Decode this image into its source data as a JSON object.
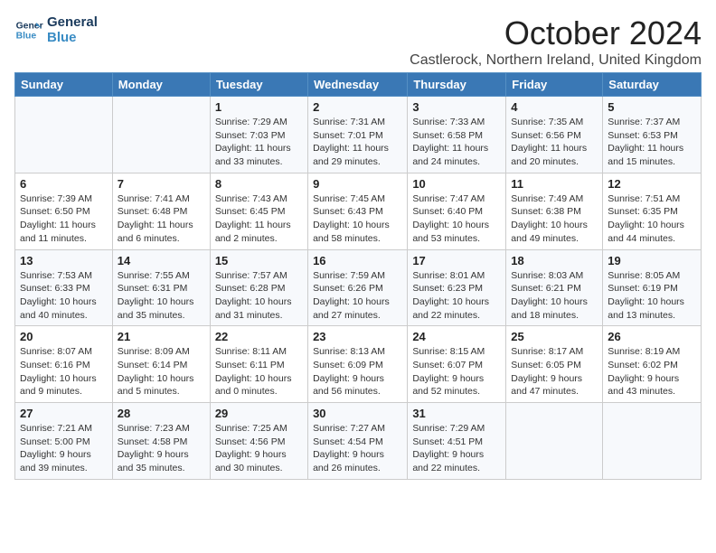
{
  "logo": {
    "line1": "General",
    "line2": "Blue"
  },
  "title": "October 2024",
  "location": "Castlerock, Northern Ireland, United Kingdom",
  "days_header": [
    "Sunday",
    "Monday",
    "Tuesday",
    "Wednesday",
    "Thursday",
    "Friday",
    "Saturday"
  ],
  "weeks": [
    [
      {
        "num": "",
        "info": ""
      },
      {
        "num": "",
        "info": ""
      },
      {
        "num": "1",
        "info": "Sunrise: 7:29 AM\nSunset: 7:03 PM\nDaylight: 11 hours\nand 33 minutes."
      },
      {
        "num": "2",
        "info": "Sunrise: 7:31 AM\nSunset: 7:01 PM\nDaylight: 11 hours\nand 29 minutes."
      },
      {
        "num": "3",
        "info": "Sunrise: 7:33 AM\nSunset: 6:58 PM\nDaylight: 11 hours\nand 24 minutes."
      },
      {
        "num": "4",
        "info": "Sunrise: 7:35 AM\nSunset: 6:56 PM\nDaylight: 11 hours\nand 20 minutes."
      },
      {
        "num": "5",
        "info": "Sunrise: 7:37 AM\nSunset: 6:53 PM\nDaylight: 11 hours\nand 15 minutes."
      }
    ],
    [
      {
        "num": "6",
        "info": "Sunrise: 7:39 AM\nSunset: 6:50 PM\nDaylight: 11 hours\nand 11 minutes."
      },
      {
        "num": "7",
        "info": "Sunrise: 7:41 AM\nSunset: 6:48 PM\nDaylight: 11 hours\nand 6 minutes."
      },
      {
        "num": "8",
        "info": "Sunrise: 7:43 AM\nSunset: 6:45 PM\nDaylight: 11 hours\nand 2 minutes."
      },
      {
        "num": "9",
        "info": "Sunrise: 7:45 AM\nSunset: 6:43 PM\nDaylight: 10 hours\nand 58 minutes."
      },
      {
        "num": "10",
        "info": "Sunrise: 7:47 AM\nSunset: 6:40 PM\nDaylight: 10 hours\nand 53 minutes."
      },
      {
        "num": "11",
        "info": "Sunrise: 7:49 AM\nSunset: 6:38 PM\nDaylight: 10 hours\nand 49 minutes."
      },
      {
        "num": "12",
        "info": "Sunrise: 7:51 AM\nSunset: 6:35 PM\nDaylight: 10 hours\nand 44 minutes."
      }
    ],
    [
      {
        "num": "13",
        "info": "Sunrise: 7:53 AM\nSunset: 6:33 PM\nDaylight: 10 hours\nand 40 minutes."
      },
      {
        "num": "14",
        "info": "Sunrise: 7:55 AM\nSunset: 6:31 PM\nDaylight: 10 hours\nand 35 minutes."
      },
      {
        "num": "15",
        "info": "Sunrise: 7:57 AM\nSunset: 6:28 PM\nDaylight: 10 hours\nand 31 minutes."
      },
      {
        "num": "16",
        "info": "Sunrise: 7:59 AM\nSunset: 6:26 PM\nDaylight: 10 hours\nand 27 minutes."
      },
      {
        "num": "17",
        "info": "Sunrise: 8:01 AM\nSunset: 6:23 PM\nDaylight: 10 hours\nand 22 minutes."
      },
      {
        "num": "18",
        "info": "Sunrise: 8:03 AM\nSunset: 6:21 PM\nDaylight: 10 hours\nand 18 minutes."
      },
      {
        "num": "19",
        "info": "Sunrise: 8:05 AM\nSunset: 6:19 PM\nDaylight: 10 hours\nand 13 minutes."
      }
    ],
    [
      {
        "num": "20",
        "info": "Sunrise: 8:07 AM\nSunset: 6:16 PM\nDaylight: 10 hours\nand 9 minutes."
      },
      {
        "num": "21",
        "info": "Sunrise: 8:09 AM\nSunset: 6:14 PM\nDaylight: 10 hours\nand 5 minutes."
      },
      {
        "num": "22",
        "info": "Sunrise: 8:11 AM\nSunset: 6:11 PM\nDaylight: 10 hours\nand 0 minutes."
      },
      {
        "num": "23",
        "info": "Sunrise: 8:13 AM\nSunset: 6:09 PM\nDaylight: 9 hours\nand 56 minutes."
      },
      {
        "num": "24",
        "info": "Sunrise: 8:15 AM\nSunset: 6:07 PM\nDaylight: 9 hours\nand 52 minutes."
      },
      {
        "num": "25",
        "info": "Sunrise: 8:17 AM\nSunset: 6:05 PM\nDaylight: 9 hours\nand 47 minutes."
      },
      {
        "num": "26",
        "info": "Sunrise: 8:19 AM\nSunset: 6:02 PM\nDaylight: 9 hours\nand 43 minutes."
      }
    ],
    [
      {
        "num": "27",
        "info": "Sunrise: 7:21 AM\nSunset: 5:00 PM\nDaylight: 9 hours\nand 39 minutes."
      },
      {
        "num": "28",
        "info": "Sunrise: 7:23 AM\nSunset: 4:58 PM\nDaylight: 9 hours\nand 35 minutes."
      },
      {
        "num": "29",
        "info": "Sunrise: 7:25 AM\nSunset: 4:56 PM\nDaylight: 9 hours\nand 30 minutes."
      },
      {
        "num": "30",
        "info": "Sunrise: 7:27 AM\nSunset: 4:54 PM\nDaylight: 9 hours\nand 26 minutes."
      },
      {
        "num": "31",
        "info": "Sunrise: 7:29 AM\nSunset: 4:51 PM\nDaylight: 9 hours\nand 22 minutes."
      },
      {
        "num": "",
        "info": ""
      },
      {
        "num": "",
        "info": ""
      }
    ]
  ]
}
